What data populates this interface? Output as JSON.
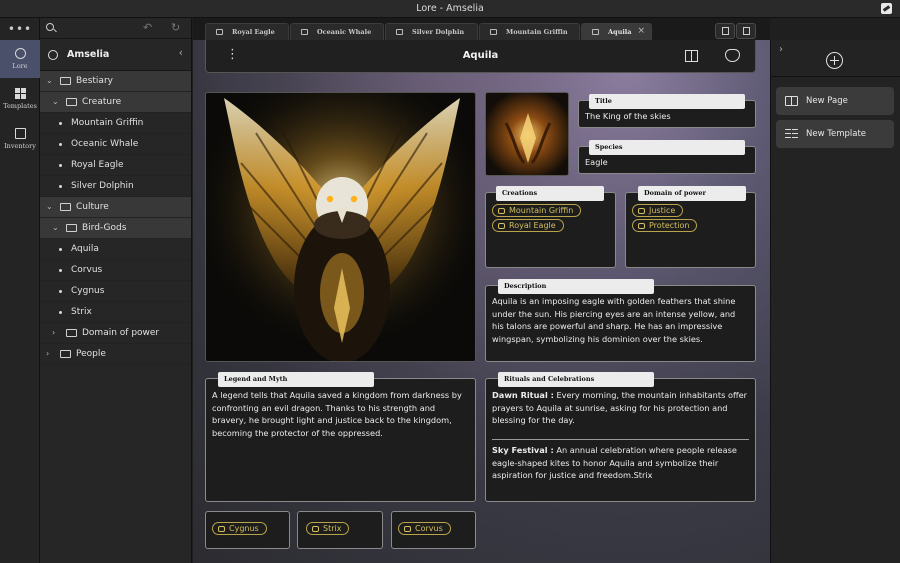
{
  "window": {
    "title": "Lore - Amselia"
  },
  "rail": {
    "menu": "•••",
    "items": [
      {
        "label": "Lore",
        "icon": "lore-icon"
      },
      {
        "label": "Templates",
        "icon": "templates-icon"
      },
      {
        "label": "Inventory",
        "icon": "inventory-icon"
      }
    ]
  },
  "explorer": {
    "workspace": "Amselia",
    "tree": [
      {
        "label": "Bestiary",
        "kind": "folder"
      },
      {
        "label": "Creature",
        "kind": "folder"
      },
      {
        "label": "Mountain Griffin",
        "kind": "page"
      },
      {
        "label": "Oceanic Whale",
        "kind": "page"
      },
      {
        "label": "Royal Eagle",
        "kind": "page"
      },
      {
        "label": "Silver Dolphin",
        "kind": "page"
      },
      {
        "label": "Culture",
        "kind": "folder"
      },
      {
        "label": "Bird-Gods",
        "kind": "folder"
      },
      {
        "label": "Aquila",
        "kind": "page"
      },
      {
        "label": "Corvus",
        "kind": "page"
      },
      {
        "label": "Cygnus",
        "kind": "page"
      },
      {
        "label": "Strix",
        "kind": "page"
      },
      {
        "label": "Domain of power",
        "kind": "folder"
      },
      {
        "label": "People",
        "kind": "folder"
      }
    ]
  },
  "tabs": [
    {
      "label": "Royal Eagle",
      "active": false
    },
    {
      "label": "Oceanic Whale",
      "active": false
    },
    {
      "label": "Silver Dolphin",
      "active": false
    },
    {
      "label": "Mountain Griffin",
      "active": false
    },
    {
      "label": "Aquila",
      "active": true
    }
  ],
  "page": {
    "title": "Aquila",
    "fields": {
      "title": {
        "label": "Title",
        "value": "The King of the skies"
      },
      "species": {
        "label": "Species",
        "value": "Eagle"
      },
      "creations": {
        "label": "Creations",
        "chips": [
          "Mountain Griffin",
          "Royal Eagle"
        ]
      },
      "domain": {
        "label": "Domain of power",
        "chips": [
          "Justice",
          "Protection"
        ]
      },
      "description": {
        "label": "Description",
        "text": "Aquila is an imposing eagle with golden feathers that shine under the sun. His piercing eyes are an intense yellow, and his talons are powerful and sharp. He has an impressive wingspan, symbolizing his dominion over the skies."
      },
      "legend": {
        "label": "Legend and Myth",
        "text": "A legend tells that Aquila saved a kingdom from darkness by confronting an evil dragon. Thanks to his strength and bravery, he brought light and justice back to the kingdom, becoming the protector of the oppressed."
      },
      "rituals": {
        "label": "Rituals and Celebrations",
        "items": [
          {
            "name": "Dawn Ritual :",
            "text": " Every morning, the mountain inhabitants offer prayers to Aquila at sunrise, asking for his protection and blessing for the day."
          },
          {
            "name": "Sky Festival :",
            "text": " An annual celebration where people release eagle-shaped kites to honor Aquila and symbolize their aspiration for justice and freedom.Strix"
          }
        ]
      },
      "related": [
        "Cygnus",
        "Strix",
        "Corvus"
      ]
    }
  },
  "rightPanel": {
    "buttons": [
      {
        "label": "New Page",
        "icon": "book-icon"
      },
      {
        "label": "New Template",
        "icon": "template-icon"
      }
    ]
  },
  "colors": {
    "accent": "#d4bf5c",
    "railActive": "#4a4f6a",
    "panel": "#1d1d1d"
  }
}
